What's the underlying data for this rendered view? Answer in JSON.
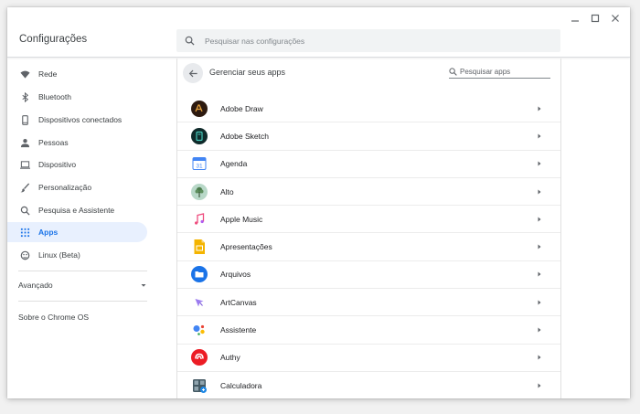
{
  "window": {
    "title": "Configurações",
    "caption": {
      "minimize": "minimize-icon",
      "maximize": "maximize-icon",
      "close": "close-icon"
    }
  },
  "search": {
    "placeholder": "Pesquisar nas configurações"
  },
  "sidebar": {
    "items": [
      {
        "label": "Rede",
        "icon": "wifi-icon",
        "active": false
      },
      {
        "label": "Bluetooth",
        "icon": "bluetooth-icon",
        "active": false
      },
      {
        "label": "Dispositivos conectados",
        "icon": "phone-icon",
        "active": false
      },
      {
        "label": "Pessoas",
        "icon": "person-icon",
        "active": false
      },
      {
        "label": "Dispositivo",
        "icon": "laptop-icon",
        "active": false
      },
      {
        "label": "Personalização",
        "icon": "brush-icon",
        "active": false
      },
      {
        "label": "Pesquisa e Assistente",
        "icon": "search-icon",
        "active": false
      },
      {
        "label": "Apps",
        "icon": "apps-grid-icon",
        "active": true
      },
      {
        "label": "Linux (Beta)",
        "icon": "linux-icon",
        "active": false
      }
    ],
    "advanced": "Avançado",
    "about": "Sobre o Chrome OS"
  },
  "main": {
    "title": "Gerenciar seus apps",
    "app_search_placeholder": "Pesquisar apps",
    "apps": [
      {
        "name": "Adobe Draw",
        "icon": "adobe-draw-icon"
      },
      {
        "name": "Adobe Sketch",
        "icon": "adobe-sketch-icon"
      },
      {
        "name": "Agenda",
        "icon": "calendar-icon",
        "icon_text": "31"
      },
      {
        "name": "Alto",
        "icon": "alto-icon"
      },
      {
        "name": "Apple Music",
        "icon": "music-note-icon"
      },
      {
        "name": "Apresentações",
        "icon": "slides-icon"
      },
      {
        "name": "Arquivos",
        "icon": "files-folder-icon"
      },
      {
        "name": "ArtCanvas",
        "icon": "artcanvas-icon"
      },
      {
        "name": "Assistente",
        "icon": "assistant-icon"
      },
      {
        "name": "Authy",
        "icon": "authy-icon"
      },
      {
        "name": "Calculadora",
        "icon": "calculator-icon"
      }
    ]
  },
  "colors": {
    "accent": "#1a73e8",
    "active_bg": "#e8f0fe",
    "text": "#3c4043",
    "icon_gray": "#5f6368"
  }
}
